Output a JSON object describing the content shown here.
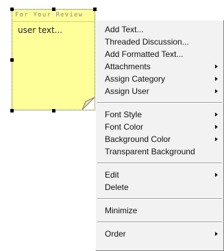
{
  "note": {
    "title": "For Your Review",
    "body": "user text...",
    "fill_color": "#ffff99"
  },
  "menu": {
    "groups": [
      [
        {
          "label": "Add Text...",
          "submenu": false
        },
        {
          "label": "Threaded Discussion...",
          "submenu": false
        },
        {
          "label": "Add Formatted Text...",
          "submenu": false
        },
        {
          "label": "Attachments",
          "submenu": true
        },
        {
          "label": "Assign Category",
          "submenu": true
        },
        {
          "label": "Assign User",
          "submenu": true
        }
      ],
      [
        {
          "label": "Font Style",
          "submenu": true
        },
        {
          "label": "Font Color",
          "submenu": true
        },
        {
          "label": "Background Color",
          "submenu": true
        },
        {
          "label": "Transparent Background",
          "submenu": false
        }
      ],
      [
        {
          "label": "Edit",
          "submenu": true
        },
        {
          "label": "Delete",
          "submenu": false
        }
      ],
      [
        {
          "label": "Minimize",
          "submenu": false
        }
      ],
      [
        {
          "label": "Order",
          "submenu": true
        }
      ]
    ]
  }
}
